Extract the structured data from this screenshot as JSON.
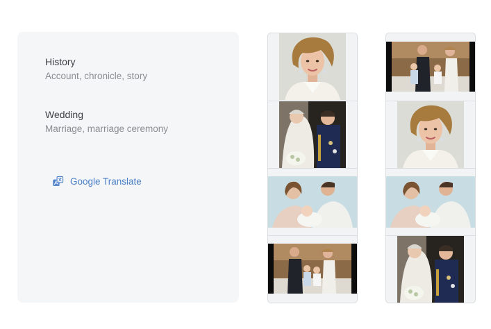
{
  "definitions": {
    "items": [
      {
        "word": "History",
        "gloss": "Account, chronicle, story"
      },
      {
        "word": "Wedding",
        "gloss": "Marriage, marriage ceremony"
      }
    ],
    "translate_link": {
      "label": "Google Translate",
      "icon": "translate-icon"
    }
  },
  "image_strips": {
    "columns": [
      {
        "name": "left-strip",
        "images": [
          "portrait",
          "wedding-kiss",
          "family-baby",
          "family-group"
        ]
      },
      {
        "name": "right-strip",
        "images": [
          "family-group",
          "portrait",
          "family-baby",
          "wedding-kiss"
        ]
      }
    ]
  },
  "colors": {
    "panel_bg": "#f5f6f8",
    "link": "#4a7fc7",
    "strip_border": "#dadce0"
  }
}
